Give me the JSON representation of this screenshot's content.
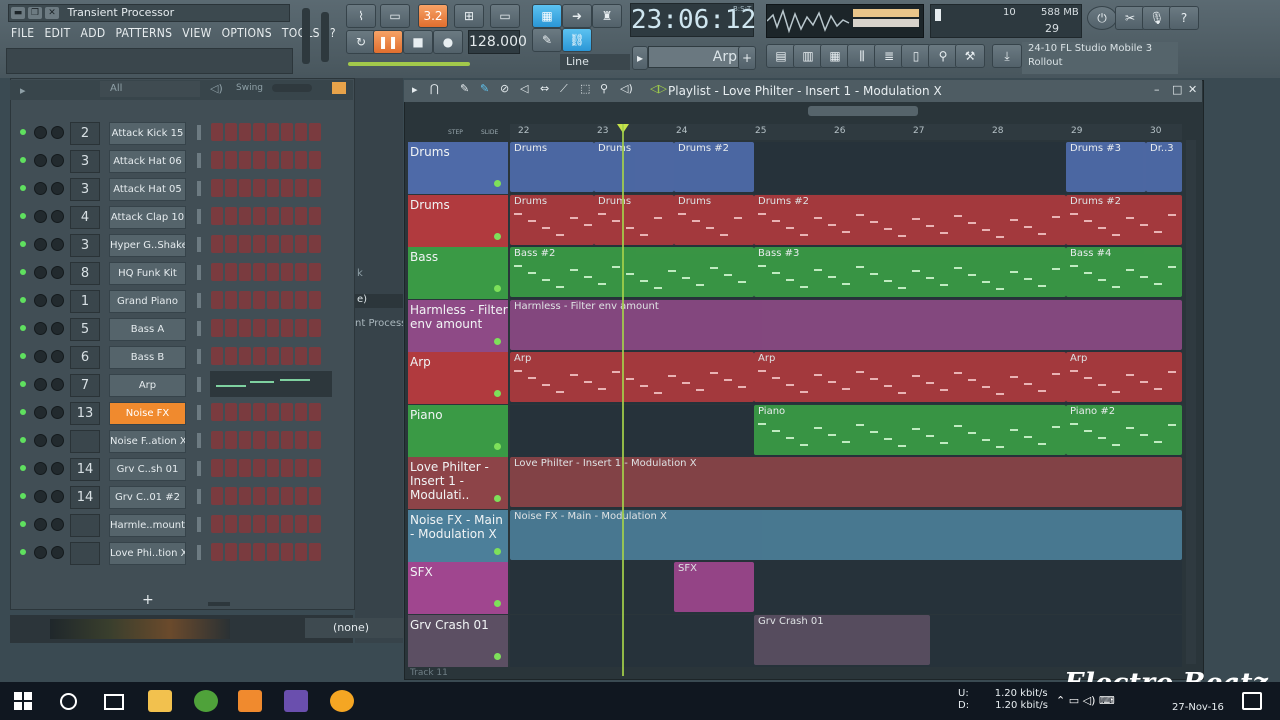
{
  "window": {
    "title": "Transient Processor"
  },
  "menu": [
    "FILE",
    "EDIT",
    "ADD",
    "PATTERNS",
    "VIEW",
    "OPTIONS",
    "TOOLS",
    "?"
  ],
  "toolbar": {
    "clock_main": "23:06",
    "clock_sub": ":12",
    "clock_small": "B:S:T",
    "tempo": "128.000",
    "cpu_value": "10",
    "mem_value": "588 MB",
    "poly_value": "29",
    "snap_label": "Line",
    "arp_label": "Arp",
    "news_line1": "24-10  FL Studio Mobile 3",
    "news_line2": "Rollout"
  },
  "rack": {
    "filter": "All",
    "swing_label": "Swing",
    "channels": [
      {
        "num": "2",
        "name": "Attack Kick 15",
        "highlight": false
      },
      {
        "num": "3",
        "name": "Attack Hat 06",
        "highlight": false
      },
      {
        "num": "3",
        "name": "Attack Hat 05",
        "highlight": false
      },
      {
        "num": "4",
        "name": "Attack Clap 10",
        "highlight": false
      },
      {
        "num": "3",
        "name": "Hyper G..Shaker",
        "highlight": false
      },
      {
        "num": "8",
        "name": "HQ Funk Kit",
        "highlight": false
      },
      {
        "num": "1",
        "name": "Grand Piano",
        "highlight": false
      },
      {
        "num": "5",
        "name": "Bass A",
        "highlight": false
      },
      {
        "num": "6",
        "name": "Bass B",
        "highlight": false
      },
      {
        "num": "7",
        "name": "Arp",
        "highlight": false
      },
      {
        "num": "13",
        "name": "Noise FX",
        "highlight": true
      },
      {
        "num": "",
        "name": "Noise F..ation X",
        "highlight": false
      },
      {
        "num": "14",
        "name": "Grv C..sh 01",
        "highlight": false
      },
      {
        "num": "14",
        "name": "Grv C..01 #2",
        "highlight": false
      },
      {
        "num": "",
        "name": "Harmle..mount",
        "highlight": false
      },
      {
        "num": "",
        "name": "Love Phi..tion X",
        "highlight": false
      }
    ],
    "add_button": "+"
  },
  "mixer_strip": {
    "label1": "e)",
    "label2": "nt Process",
    "label3": "k"
  },
  "none_select": "(none)",
  "playlist": {
    "title": "Playlist - Love Philter - Insert 1 - Modulation X",
    "step_label": "STEP",
    "slide_label": "SLIDE",
    "bars": [
      "22",
      "23",
      "24",
      "25",
      "26",
      "27",
      "28",
      "29",
      "30"
    ],
    "tracks": [
      {
        "name": "Drums",
        "color": "#4e6aa8",
        "clips": [
          {
            "label": "Drums"
          },
          {
            "label": "Drums"
          },
          {
            "label": "Drums #2"
          },
          {
            "label": "Drums #3"
          },
          {
            "label": "Dr..3"
          }
        ]
      },
      {
        "name": "Drums",
        "color": "#b13a3e",
        "clips": [
          {
            "label": "Drums"
          },
          {
            "label": "Drums"
          },
          {
            "label": "Drums"
          },
          {
            "label": "Drums #2"
          },
          {
            "label": "Drums #2"
          }
        ]
      },
      {
        "name": "Bass",
        "color": "#3a9a45",
        "clips": [
          {
            "label": "Bass #2"
          },
          {
            "label": "Bass #3"
          },
          {
            "label": "Bass #4"
          }
        ]
      },
      {
        "name": "Harmless - Filter env amount",
        "color": "#8e4a86",
        "clips": [
          {
            "label": "Harmless - Filter env amount"
          }
        ]
      },
      {
        "name": "Arp",
        "color": "#b13a3e",
        "clips": [
          {
            "label": "Arp"
          },
          {
            "label": "Arp"
          },
          {
            "label": "Arp"
          }
        ]
      },
      {
        "name": "Piano",
        "color": "#3a9a45",
        "clips": [
          {
            "label": "Piano"
          },
          {
            "label": "Piano #2"
          }
        ]
      },
      {
        "name": "Love Philter - Insert 1 - Modulati..",
        "color": "#8d4448",
        "clips": [
          {
            "label": "Love Philter - Insert 1 - Modulation X"
          }
        ]
      },
      {
        "name": "Noise FX - Main - Modulation X",
        "color": "#4c7f9a",
        "clips": [
          {
            "label": "Noise FX - Main - Modulation X"
          }
        ]
      },
      {
        "name": "SFX",
        "color": "#a0468f",
        "clips": [
          {
            "label": "SFX"
          }
        ]
      },
      {
        "name": "Grv Crash 01",
        "color": "#5c4f63",
        "clips": [
          {
            "label": "Grv Crash 01"
          }
        ]
      }
    ],
    "next_track": "Track 11"
  },
  "watermark": "Electro Beatz",
  "taskbar": {
    "net_up_label": "U:",
    "net_down_label": "D:",
    "net_up": "1.20 kbit/s",
    "net_down": "1.20 kbit/s",
    "date": "27-Nov-16"
  }
}
